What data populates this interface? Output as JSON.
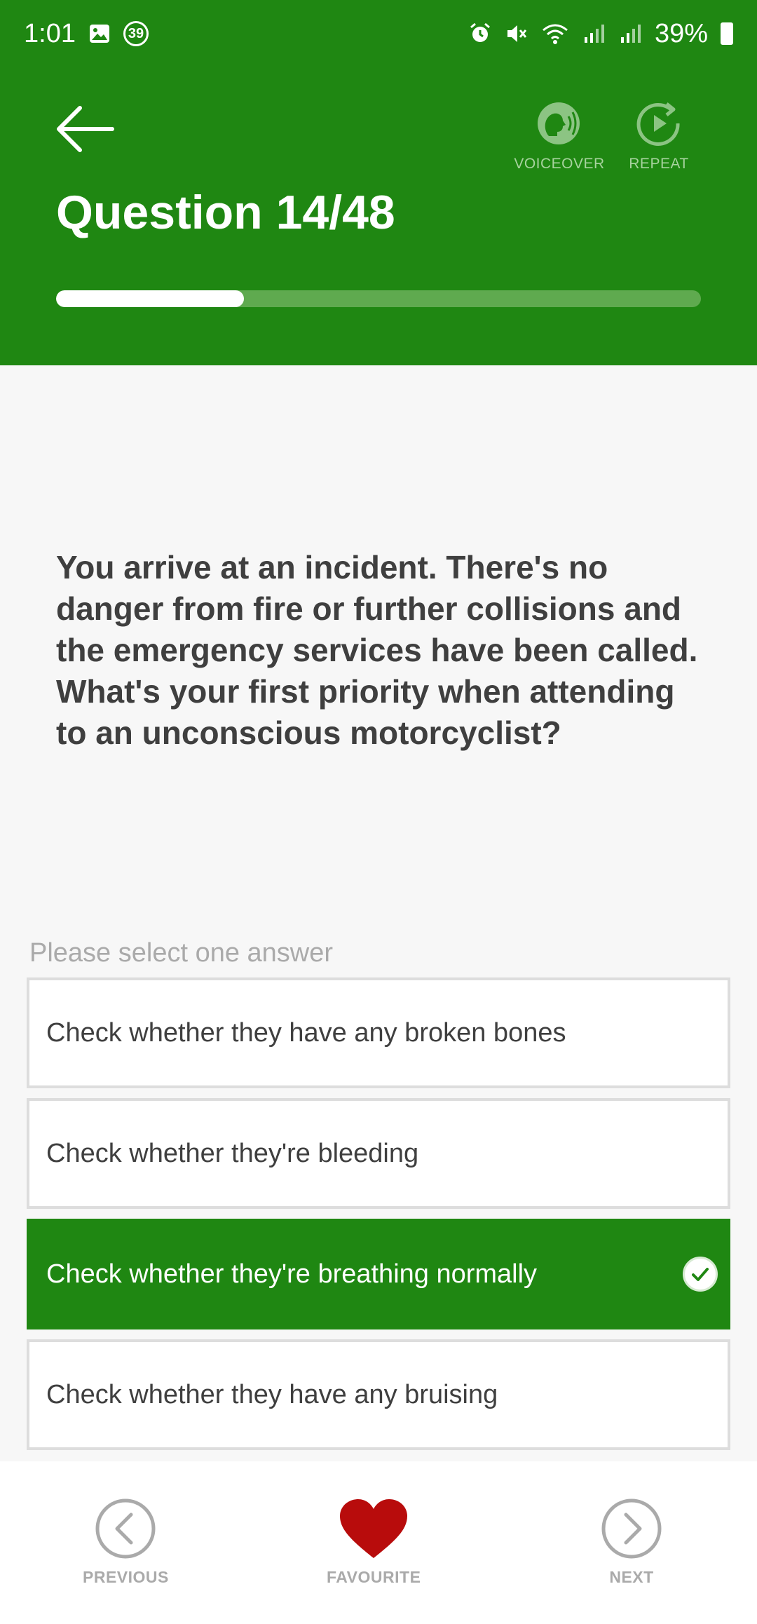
{
  "status_bar": {
    "time": "1:01",
    "notification_count": "39",
    "battery": "39%"
  },
  "header": {
    "question_title": "Question 14/48",
    "voiceover_label": "VOICEOVER",
    "repeat_label": "REPEAT",
    "progress_fraction": 0.2917
  },
  "question": {
    "text": "You arrive at an incident. There's no danger from fire or further collisions and the emergency services have been called. What's your first priority when attending to an unconscious motorcyclist?",
    "prompt": "Please select one answer",
    "answers": [
      {
        "label": "Check whether they have any broken bones",
        "selected": false
      },
      {
        "label": "Check whether they're bleeding",
        "selected": false
      },
      {
        "label": "Check whether they're breathing normally",
        "selected": true
      },
      {
        "label": "Check whether they have any bruising",
        "selected": false
      }
    ]
  },
  "footer": {
    "previous_label": "PREVIOUS",
    "favourite_label": "FAVOURITE",
    "next_label": "NEXT"
  },
  "colors": {
    "brand_green": "#1f8712",
    "heart_red": "#b80c0c",
    "muted_gray": "#aaaaaa"
  }
}
